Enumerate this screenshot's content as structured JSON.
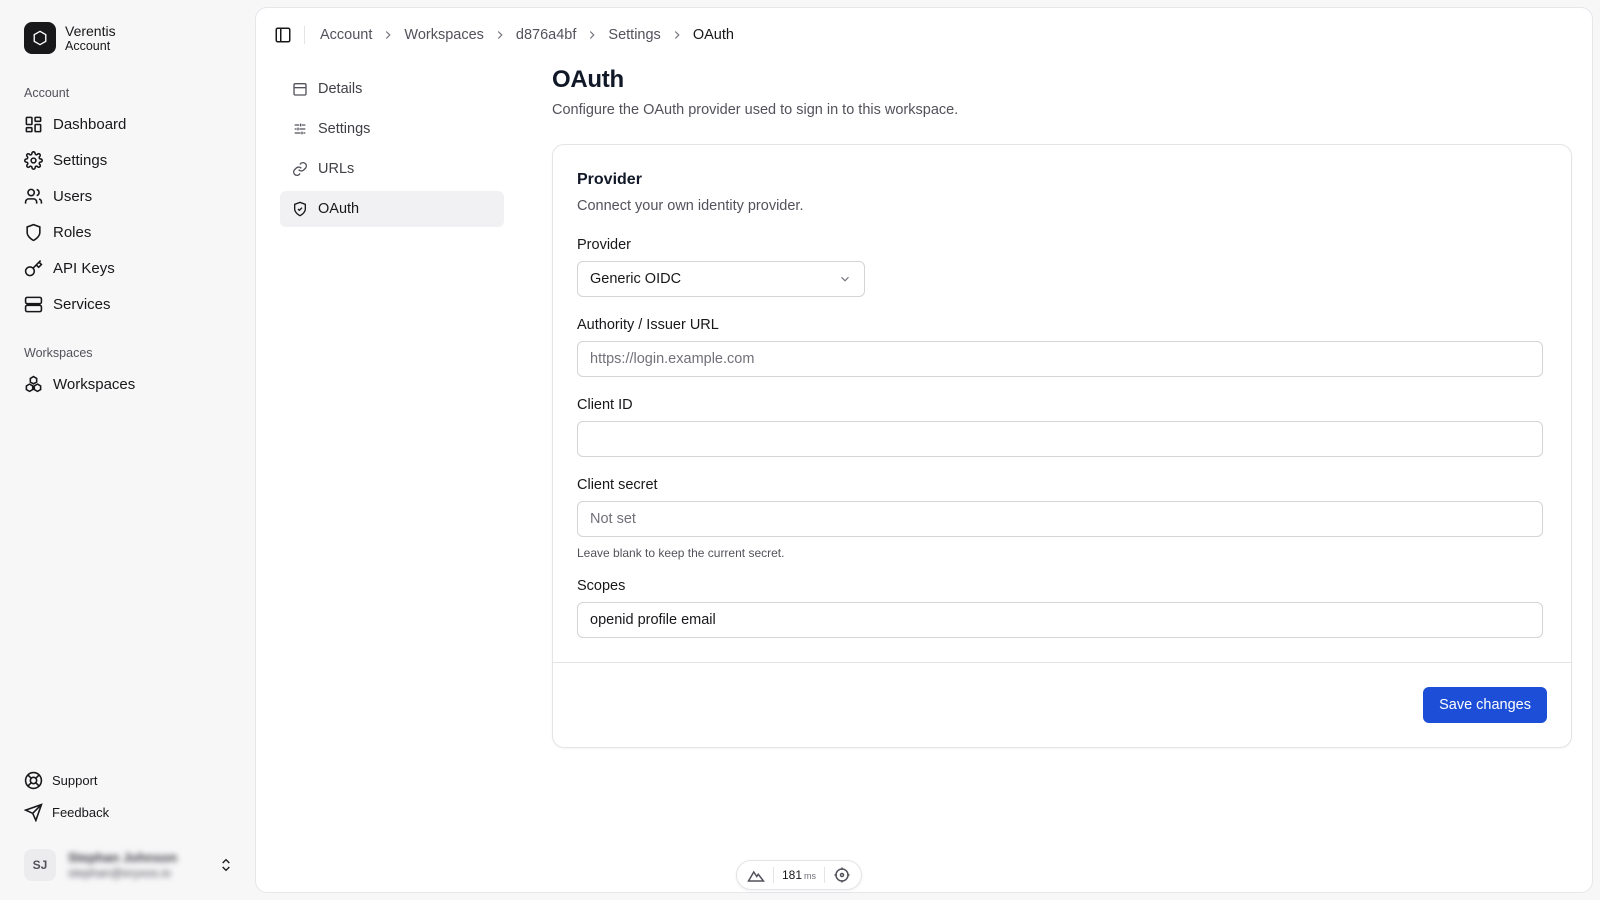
{
  "brand": {
    "name": "Verentis",
    "sub": "Account"
  },
  "sidebar": {
    "account_label": "Account",
    "account_items": [
      {
        "label": "Dashboard",
        "icon": "dashboard-icon"
      },
      {
        "label": "Settings",
        "icon": "gear-icon"
      },
      {
        "label": "Users",
        "icon": "users-icon"
      },
      {
        "label": "Roles",
        "icon": "shield-icon"
      },
      {
        "label": "API Keys",
        "icon": "key-icon"
      },
      {
        "label": "Services",
        "icon": "server-icon"
      }
    ],
    "workspaces_label": "Workspaces",
    "workspace_items": [
      {
        "label": "Workspaces",
        "icon": "workspaces-icon"
      }
    ],
    "footer_items": [
      {
        "label": "Support",
        "icon": "lifebuoy-icon"
      },
      {
        "label": "Feedback",
        "icon": "send-icon"
      }
    ],
    "user": {
      "initials": "SJ",
      "name": "Stephan Johnson",
      "email": "stephan@eryxos.io"
    }
  },
  "breadcrumb": [
    "Account",
    "Workspaces",
    "d876a4bf",
    "Settings",
    "OAuth"
  ],
  "subnav": [
    {
      "label": "Details",
      "icon": "calendar-icon",
      "active": false
    },
    {
      "label": "Settings",
      "icon": "sliders-icon",
      "active": false
    },
    {
      "label": "URLs",
      "icon": "link-icon",
      "active": false
    },
    {
      "label": "OAuth",
      "icon": "shield-check-icon",
      "active": true
    }
  ],
  "page": {
    "title": "OAuth",
    "description": "Configure the OAuth provider used to sign in to this workspace."
  },
  "card": {
    "title": "Provider",
    "description": "Connect your own identity provider.",
    "provider_label": "Provider",
    "provider_value": "Generic OIDC",
    "authority_label": "Authority / Issuer URL",
    "authority_placeholder": "https://login.example.com",
    "authority_value": "",
    "client_id_label": "Client ID",
    "client_id_value": "",
    "client_secret_label": "Client secret",
    "client_secret_placeholder": "Not set",
    "client_secret_help": "Leave blank to keep the current secret.",
    "scopes_label": "Scopes",
    "scopes_value": "openid profile email",
    "save_label": "Save changes"
  },
  "devbar": {
    "ms_value": "181",
    "ms_unit": "ms"
  },
  "colors": {
    "primary": "#1d4ed8",
    "sidebar_bg": "#f7f7f8",
    "active_bg": "#f1f1f3"
  }
}
